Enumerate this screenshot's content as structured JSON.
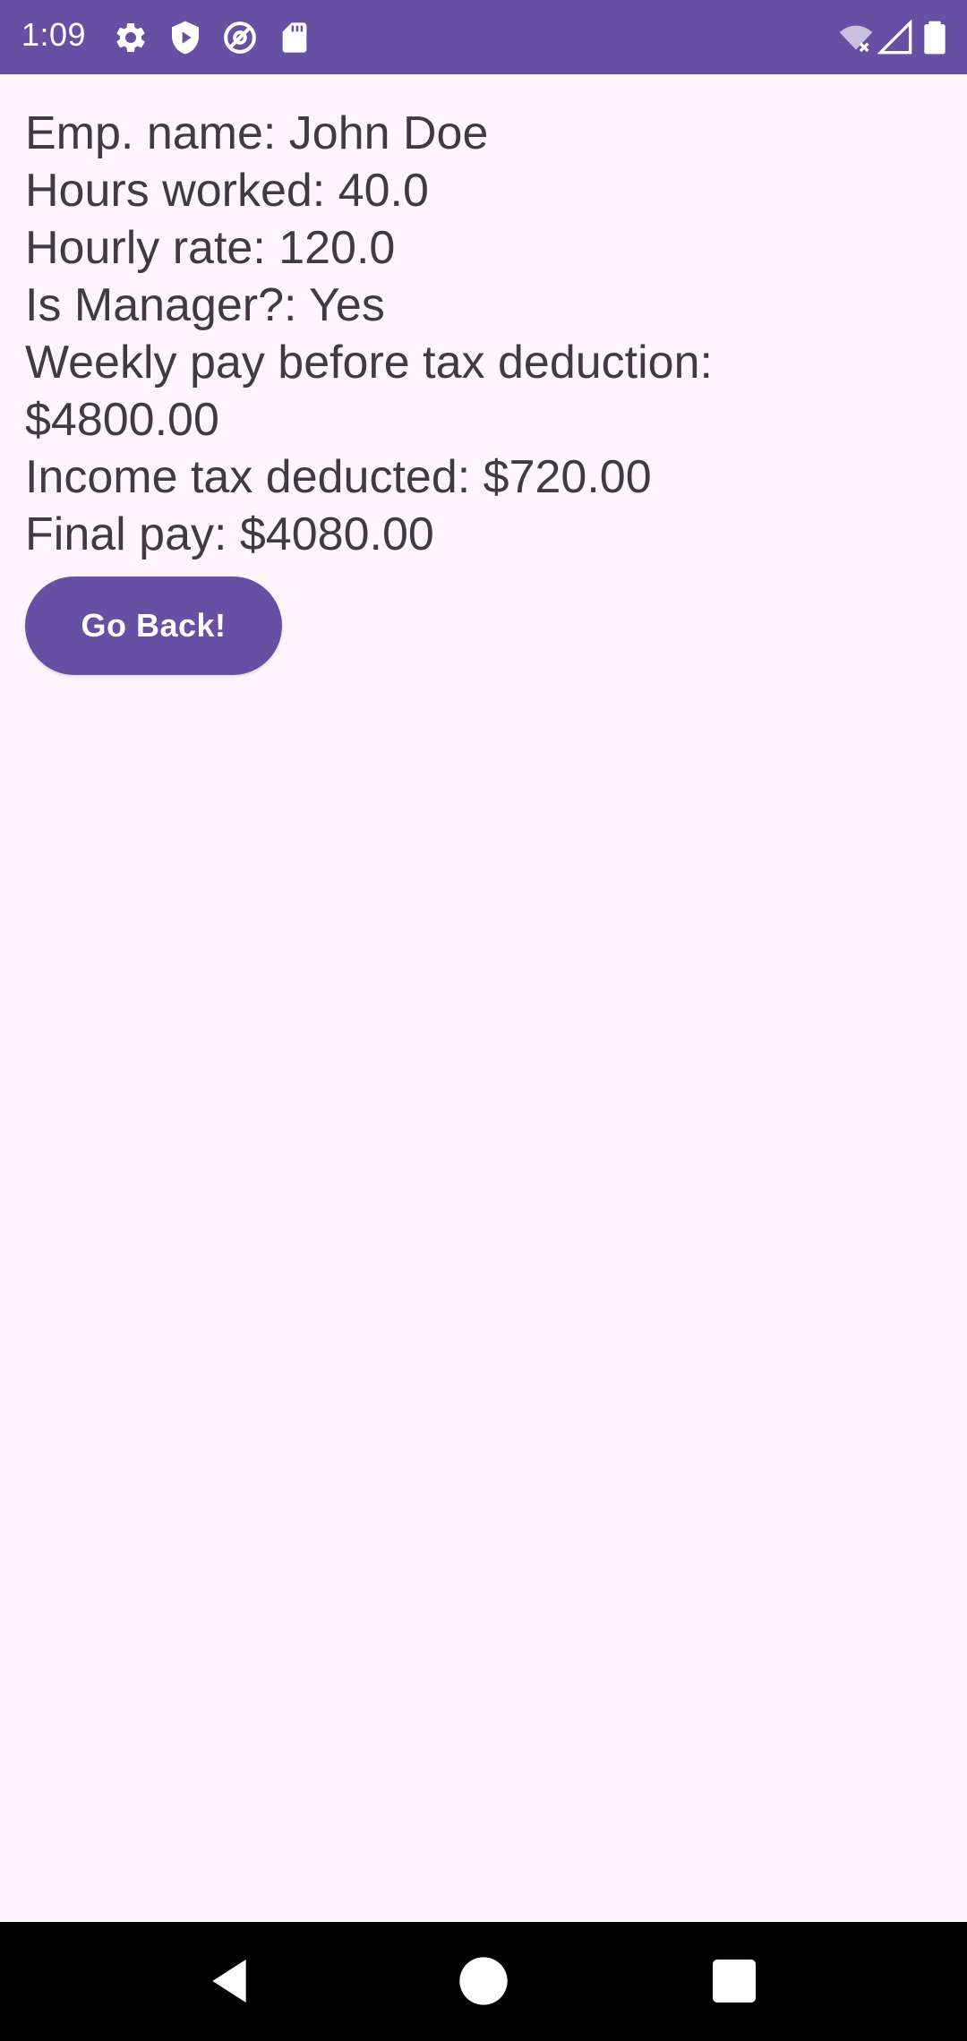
{
  "status_bar": {
    "time": "1:09",
    "background": "#6750a4",
    "icons_left": [
      "settings-icon",
      "shield-play-icon",
      "at-sign-icon",
      "sd-card-icon"
    ],
    "icons_right": [
      "wifi-off-icon",
      "signal-icon",
      "battery-icon"
    ]
  },
  "employee": {
    "name_line": "Emp. name: John Doe",
    "hours_line": "Hours worked: 40.0",
    "rate_line": "Hourly rate: 120.0",
    "manager_line": "Is Manager?: Yes",
    "weekly_pay_label": "Weekly pay before tax deduction:",
    "weekly_pay_value": "$4800.00",
    "tax_line": "Income tax deducted: $720.00",
    "final_pay_line": "Final pay: $4080.00"
  },
  "actions": {
    "go_back_label": "Go Back!",
    "accent_color": "#6750a4"
  },
  "nav_bar": {
    "buttons": [
      "back-icon",
      "home-icon",
      "recents-icon"
    ]
  }
}
